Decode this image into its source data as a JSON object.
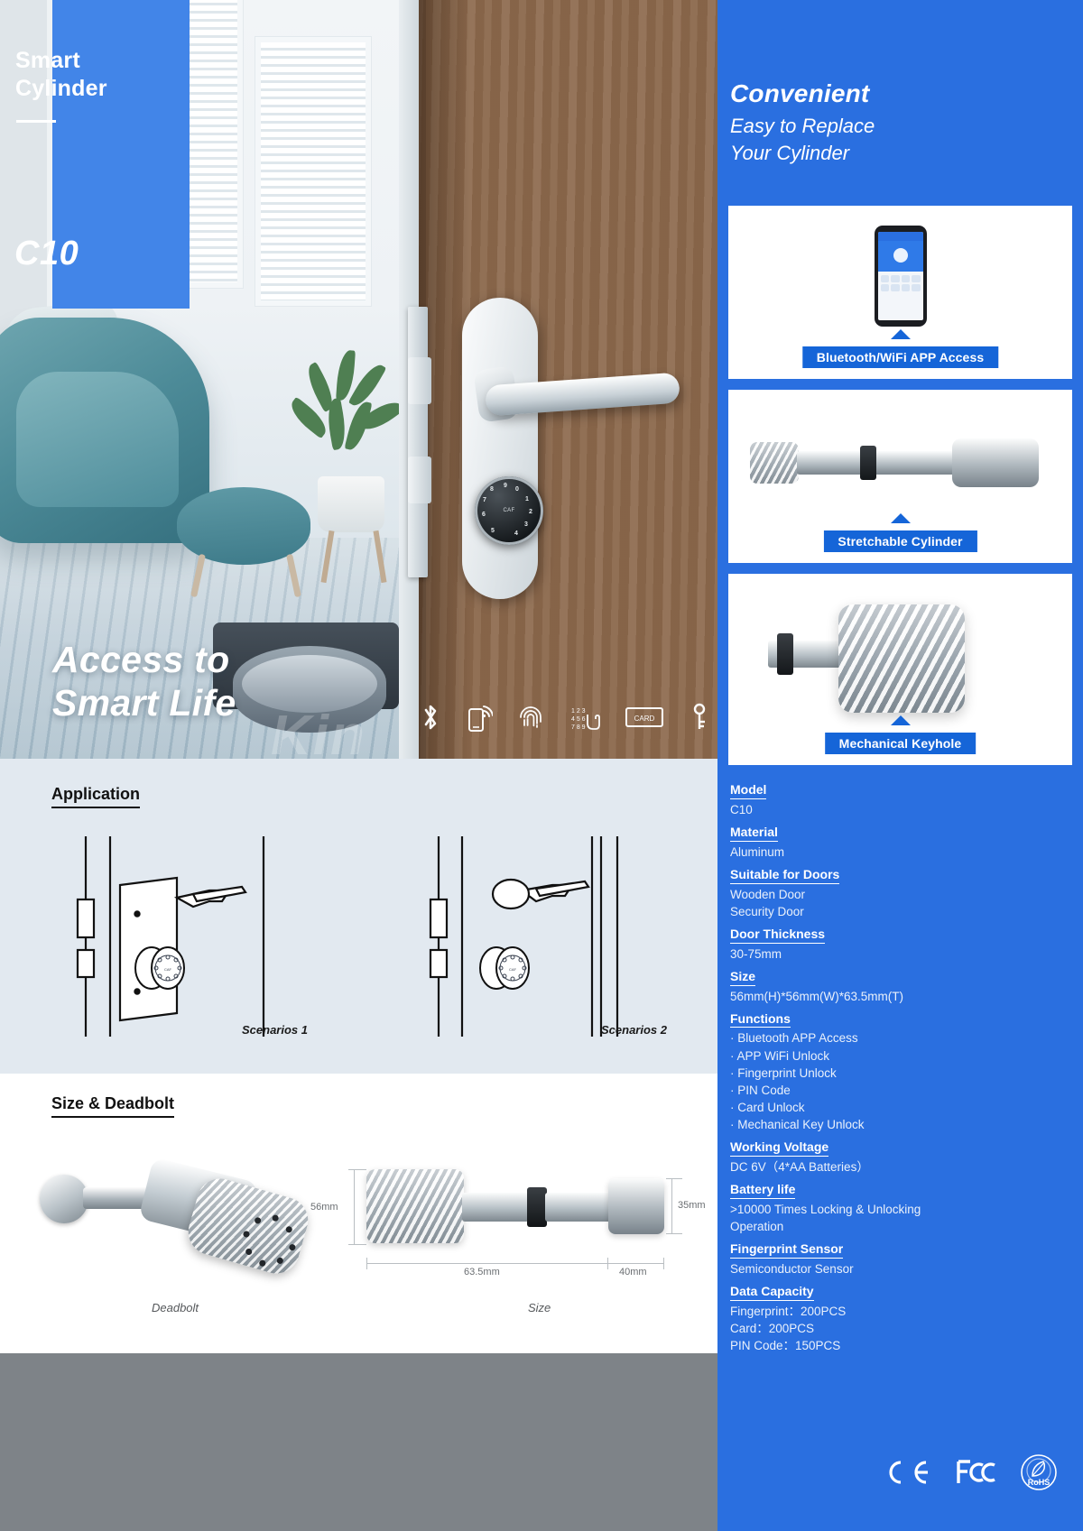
{
  "hero": {
    "badge_title": "Smart\nCylinder",
    "model_code": "C10",
    "tagline": "Access to\nSmart Life",
    "watermark": "Kin",
    "feature_icons": [
      {
        "name": "bluetooth-icon",
        "label": "Bluetooth"
      },
      {
        "name": "wifi-app-icon",
        "label": "WiFi APP"
      },
      {
        "name": "fingerprint-icon",
        "label": "Fingerprint"
      },
      {
        "name": "keypad-icon",
        "label": "PIN Keypad"
      },
      {
        "name": "card-icon",
        "label": "CARD"
      },
      {
        "name": "key-icon",
        "label": "Mechanical Key"
      }
    ],
    "keypad_digits": [
      "9",
      "0",
      "1",
      "2",
      "3",
      "8",
      "4",
      "7",
      "6",
      "5"
    ],
    "keypad_center": "CAF"
  },
  "application": {
    "title": "Application",
    "scenarios": [
      {
        "label": "Scenarios 1"
      },
      {
        "label": "Scenarios 2"
      }
    ]
  },
  "size_section": {
    "title": "Size & Deadbolt",
    "deadbolt_caption": "Deadbolt",
    "size_caption": "Size",
    "dimensions": {
      "height": "56mm",
      "right_height": "35mm",
      "length": "63.5mm",
      "cap_length": "40mm"
    }
  },
  "right": {
    "headline": "Convenient",
    "subhead": "Easy  to Replace\nYour Cylinder",
    "cards": [
      {
        "caption": "Bluetooth/WiFi APP Access",
        "icon": "smartphone-app-icon"
      },
      {
        "caption": "Stretchable Cylinder",
        "icon": "cylinder-icon"
      },
      {
        "caption": "Mechanical Keyhole",
        "icon": "keyhole-knob-icon"
      }
    ],
    "specs": [
      {
        "label": "Model",
        "value": "C10"
      },
      {
        "label": "Material",
        "value": "Aluminum"
      },
      {
        "label": "Suitable for Doors",
        "value": "Wooden Door\nSecurity Door"
      },
      {
        "label": "Door Thickness",
        "value": "30-75mm"
      },
      {
        "label": "Size",
        "value": "56mm(H)*56mm(W)*63.5mm(T)"
      },
      {
        "label": "Functions",
        "value": "· Bluetooth APP Access\n· APP WiFi Unlock\n· Fingerprint Unlock\n· PIN Code\n· Card Unlock\n· Mechanical Key Unlock"
      },
      {
        "label": "Working Voltage",
        "value": "DC 6V（4*AA Batteries）"
      },
      {
        "label": "Battery life",
        "value": ">10000 Times Locking & Unlocking\nOperation"
      },
      {
        "label": "Fingerprint Sensor",
        "value": "Semiconductor Sensor"
      },
      {
        "label": "Data Capacity",
        "value": "Fingerprint：200PCS\nCard：200PCS\nPIN Code：150PCS"
      }
    ],
    "certifications": [
      {
        "name": "ce-mark-icon",
        "text": "CE"
      },
      {
        "name": "fcc-mark-icon",
        "text": "FC"
      },
      {
        "name": "rohs-mark-icon",
        "text": "RoHS"
      }
    ]
  },
  "colors": {
    "brand_blue": "#2a6fe0",
    "badge_blue": "#4285e8",
    "pill_blue": "#1565d8",
    "app_bg": "#e2e9f0",
    "grey_bar": "#7e8388"
  }
}
